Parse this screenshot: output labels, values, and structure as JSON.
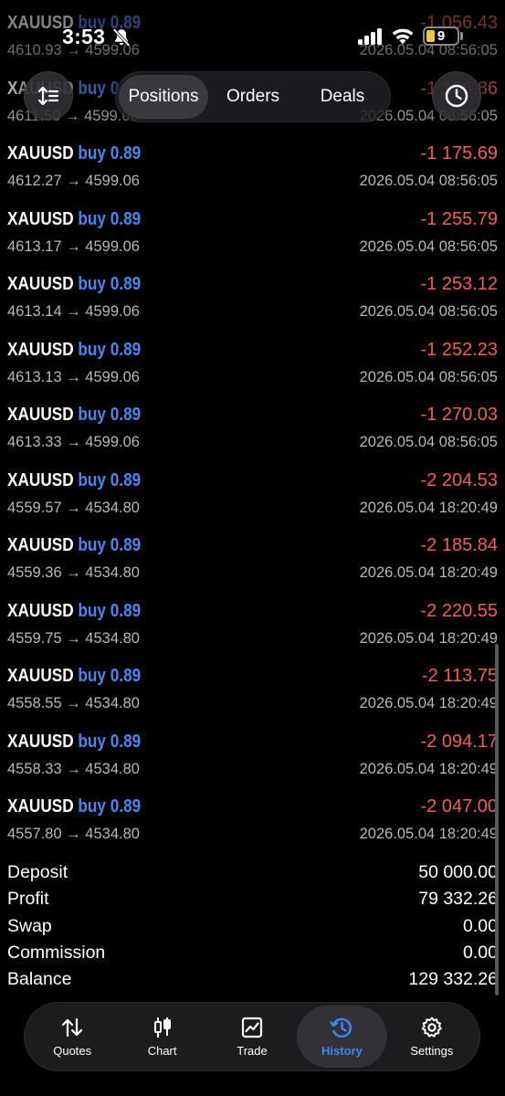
{
  "status_bar": {
    "time": "3:53",
    "battery": "9"
  },
  "segment": {
    "tabs": [
      "Positions",
      "Orders",
      "Deals"
    ],
    "active_index": 0
  },
  "deals": [
    {
      "symbol": "XAUUSD",
      "side": "buy 0.89",
      "prices": "4610.93 → 4599.06",
      "profit": "-1 056.43",
      "date": "2026.05.04 08:56:05"
    },
    {
      "symbol": "XAUUSD",
      "side": "buy 0.89",
      "prices": "4611.50 → 4599.06",
      "profit": "-1 106.86",
      "date": "2026.05.04 08:56:05"
    },
    {
      "symbol": "XAUUSD",
      "side": "buy 0.89",
      "prices": "4612.27 → 4599.06",
      "profit": "-1 175.69",
      "date": "2026.05.04 08:56:05"
    },
    {
      "symbol": "XAUUSD",
      "side": "buy 0.89",
      "prices": "4613.17 → 4599.06",
      "profit": "-1 255.79",
      "date": "2026.05.04 08:56:05"
    },
    {
      "symbol": "XAUUSD",
      "side": "buy 0.89",
      "prices": "4613.14 → 4599.06",
      "profit": "-1 253.12",
      "date": "2026.05.04 08:56:05"
    },
    {
      "symbol": "XAUUSD",
      "side": "buy 0.89",
      "prices": "4613.13 → 4599.06",
      "profit": "-1 252.23",
      "date": "2026.05.04 08:56:05"
    },
    {
      "symbol": "XAUUSD",
      "side": "buy 0.89",
      "prices": "4613.33 → 4599.06",
      "profit": "-1 270.03",
      "date": "2026.05.04 08:56:05"
    },
    {
      "symbol": "XAUUSD",
      "side": "buy 0.89",
      "prices": "4559.57 → 4534.80",
      "profit": "-2 204.53",
      "date": "2026.05.04 18:20:49"
    },
    {
      "symbol": "XAUUSD",
      "side": "buy 0.89",
      "prices": "4559.36 → 4534.80",
      "profit": "-2 185.84",
      "date": "2026.05.04 18:20:49"
    },
    {
      "symbol": "XAUUSD",
      "side": "buy 0.89",
      "prices": "4559.75 → 4534.80",
      "profit": "-2 220.55",
      "date": "2026.05.04 18:20:49"
    },
    {
      "symbol": "XAUUSD",
      "side": "buy 0.89",
      "prices": "4558.55 → 4534.80",
      "profit": "-2 113.75",
      "date": "2026.05.04 18:20:49"
    },
    {
      "symbol": "XAUUSD",
      "side": "buy 0.89",
      "prices": "4558.33 → 4534.80",
      "profit": "-2 094.17",
      "date": "2026.05.04 18:20:49"
    },
    {
      "symbol": "XAUUSD",
      "side": "buy 0.89",
      "prices": "4557.80 → 4534.80",
      "profit": "-2 047.00",
      "date": "2026.05.04 18:20:49"
    }
  ],
  "summary": [
    {
      "label": "Deposit",
      "value": "50 000.00"
    },
    {
      "label": "Profit",
      "value": "79 332.26"
    },
    {
      "label": "Swap",
      "value": "0.00"
    },
    {
      "label": "Commission",
      "value": "0.00"
    },
    {
      "label": "Balance",
      "value": "129 332.26"
    }
  ],
  "tabbar": {
    "items": [
      {
        "label": "Quotes",
        "icon": "quotes-icon"
      },
      {
        "label": "Chart",
        "icon": "chart-icon"
      },
      {
        "label": "Trade",
        "icon": "trade-icon"
      },
      {
        "label": "History",
        "icon": "history-icon"
      },
      {
        "label": "Settings",
        "icon": "settings-icon"
      }
    ],
    "active_index": 3
  },
  "colors": {
    "buy": "#4a86f0",
    "loss": "#f25f57",
    "accent": "#3d86f4",
    "background": "#000000"
  }
}
